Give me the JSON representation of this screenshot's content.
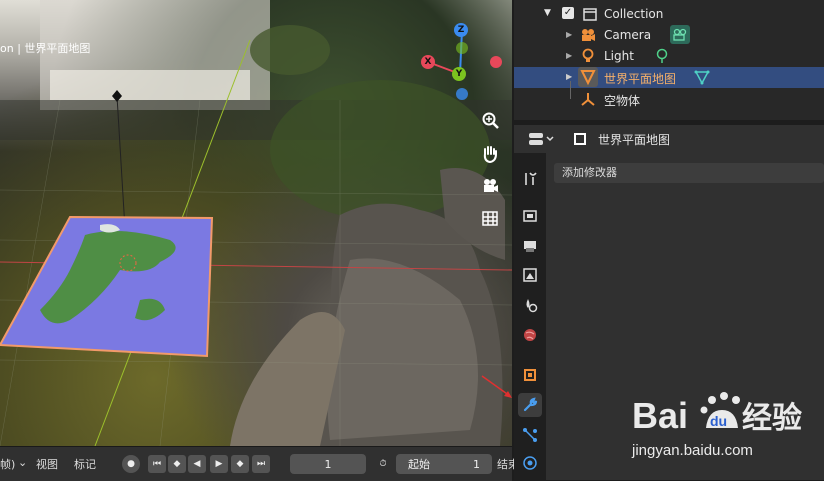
{
  "viewport": {
    "title": "on | 世界平面地图",
    "gizmo": {
      "z": "Z",
      "x": "X",
      "y": "Y"
    },
    "tools": [
      "zoom-icon",
      "pan-hand-icon",
      "camera-icon",
      "grid-icon"
    ]
  },
  "timeline": {
    "left_fragment": "帧)",
    "menu_view": "视图",
    "menu_marker": "标记",
    "current_frame": "1",
    "start_label": "起始",
    "start_value": "1",
    "end_fragment": "结束"
  },
  "outliner": {
    "collection": "Collection",
    "items": [
      {
        "label": "Camera",
        "icon": "camera-object-icon",
        "data_icon": "camera-data-icon"
      },
      {
        "label": "Light",
        "icon": "light-object-icon",
        "data_icon": "light-data-icon"
      },
      {
        "label": "世界平面地图",
        "icon": "mesh-object-icon",
        "data_icon": "mesh-data-icon",
        "selected": true
      },
      {
        "label": "空物体",
        "icon": "empty-object-icon"
      }
    ]
  },
  "properties": {
    "object_name": "世界平面地图",
    "add_modifier": "添加修改器",
    "tabs": [
      "tool-icon",
      "render-icon",
      "output-icon",
      "view-layer-icon",
      "scene-icon",
      "world-icon",
      "object-icon",
      "modifier-icon",
      "particles-icon",
      "physics-icon"
    ]
  },
  "watermark": {
    "brand": "Bai du 经验",
    "url": "jingyan.baidu.com"
  },
  "colors": {
    "selection": "#334d80",
    "axis_x": "#e8485a",
    "axis_y": "#7cc31f",
    "axis_z": "#3a8bf0",
    "active_tab": "#3d3d3d"
  }
}
